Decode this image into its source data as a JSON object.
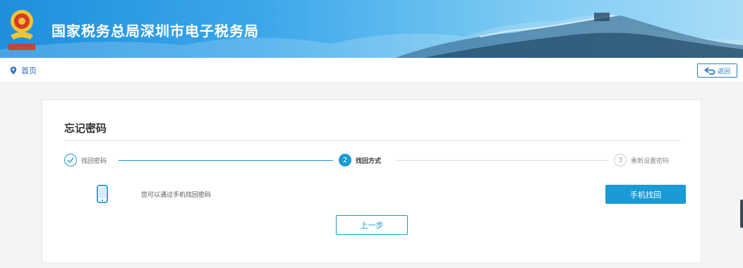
{
  "header": {
    "site_title": "国家税务总局深圳市电子税务局",
    "emblem_icon": "tax-emblem-icon",
    "colors": {
      "banner_start": "#1f8fde",
      "banner_end": "#a9dcf7"
    }
  },
  "breadcrumb": {
    "home_label": "首页",
    "home_icon": "location-pin-icon",
    "back_label": "返回",
    "back_icon": "return-arrow-icon"
  },
  "page": {
    "title": "忘记密码",
    "steps": [
      {
        "number": "✓",
        "label": "找回密码",
        "state": "completed"
      },
      {
        "number": "2",
        "label": "找回方式",
        "state": "active"
      },
      {
        "number": "3",
        "label": "重新设置密码",
        "state": "pending"
      }
    ],
    "option": {
      "icon": "mobile-phone-icon",
      "text": "您可以通过手机找回密码",
      "button_label": "手机找回"
    },
    "prev_button_label": "上一步",
    "accent_color": "#1a9ad6"
  }
}
